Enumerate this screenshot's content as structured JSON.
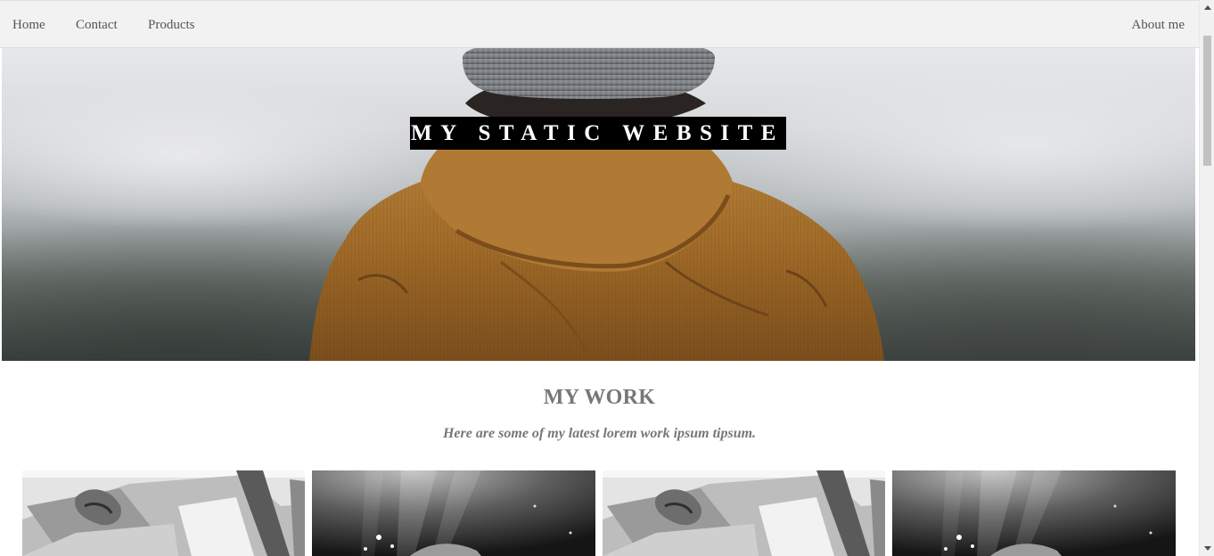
{
  "nav": {
    "home": "Home",
    "contact": "Contact",
    "products": "Products",
    "about": "About me"
  },
  "hero": {
    "title": "MY STATIC WEBSITE"
  },
  "work": {
    "title": "MY WORK",
    "subtitle": "Here are some of my latest lorem work ipsum tipsum."
  },
  "gallery": [
    {
      "image": "couple-in-van-photo"
    },
    {
      "image": "underwater-light-photo"
    },
    {
      "image": "couple-in-van-photo"
    },
    {
      "image": "underwater-light-photo"
    }
  ],
  "colors": {
    "nav_bg": "#f2f2f2",
    "nav_text": "#555555",
    "title_bg": "#000000",
    "section_text": "#777777",
    "jacket": "#a8742f"
  }
}
